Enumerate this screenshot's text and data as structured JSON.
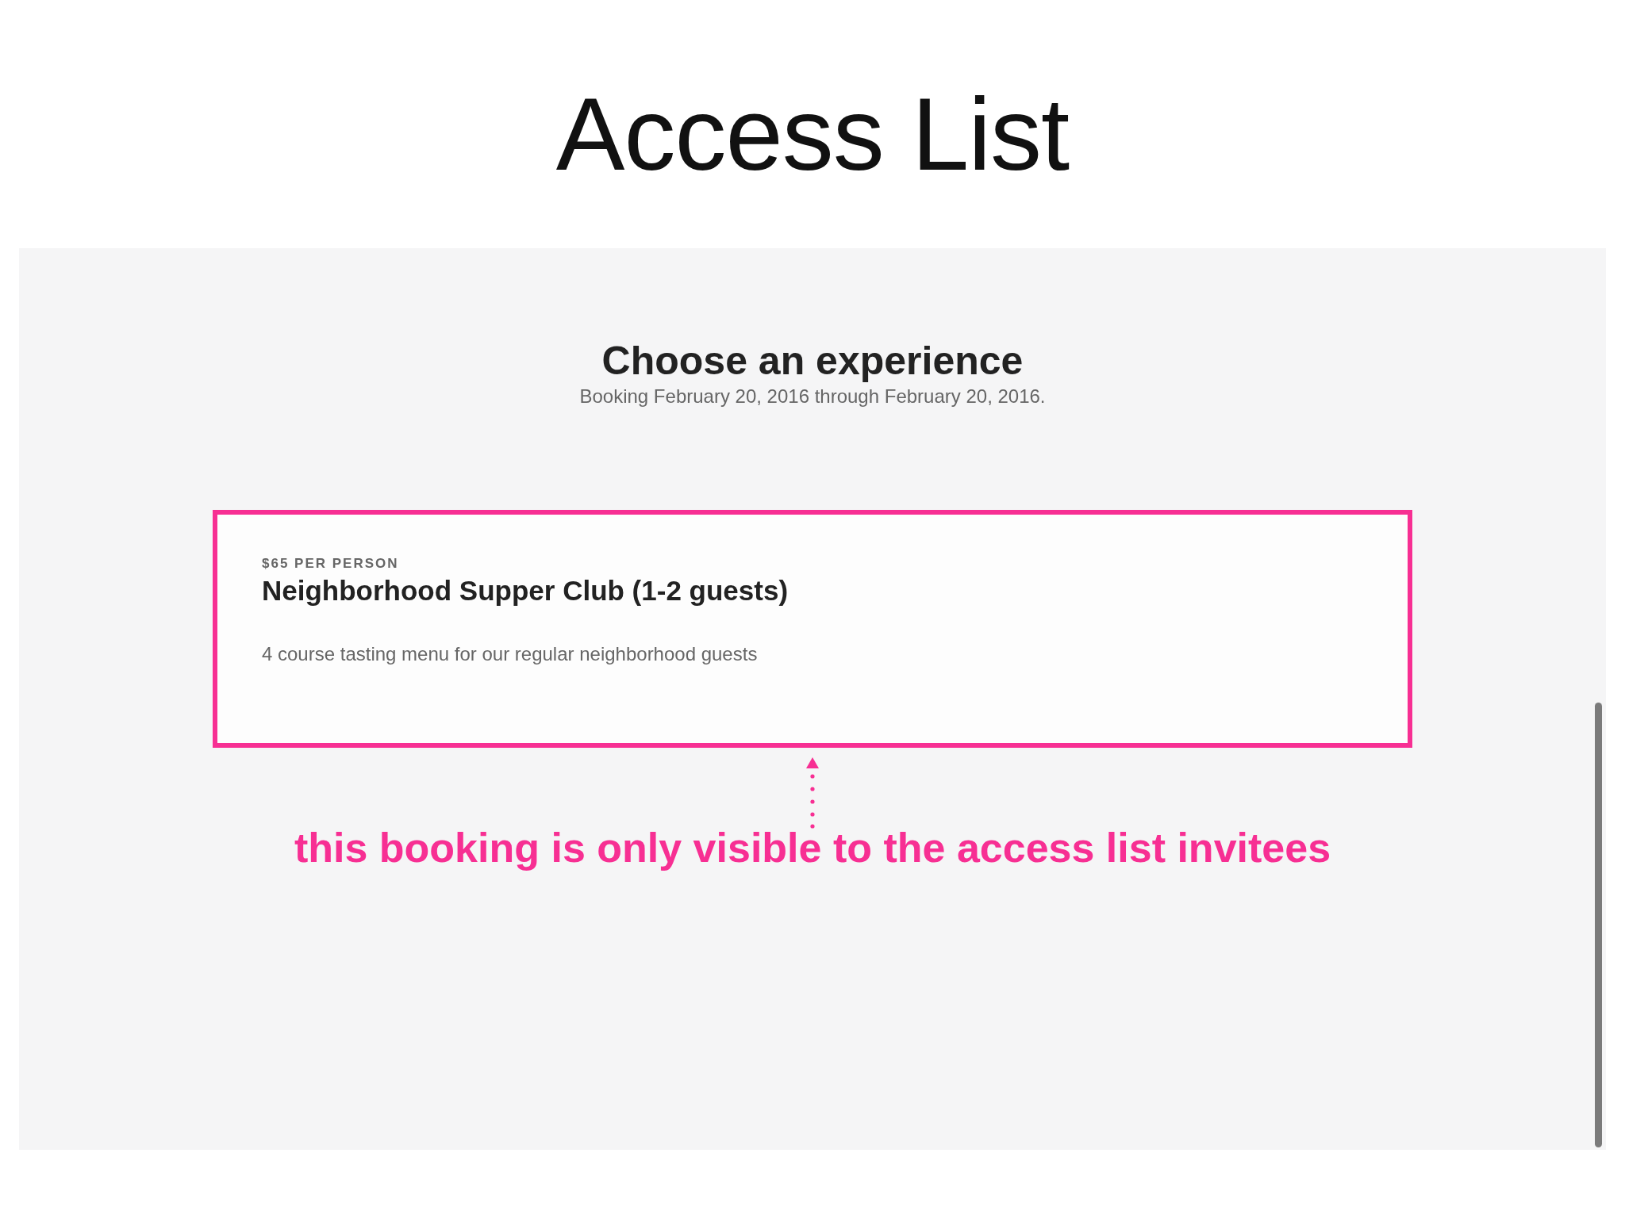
{
  "page_title": "Access List",
  "booking_page": {
    "heading": "Choose an experience",
    "subheading": "Booking February 20, 2016 through February 20, 2016.",
    "experiences": [
      {
        "price": "$65 PER PERSON",
        "name": "Neighborhood Supper Club (1-2 guests)",
        "description": "4 course tasting menu for our regular neighborhood guests",
        "highlighted": true
      }
    ]
  },
  "annotation": {
    "text": "this booking is only visible to the access list invitees"
  }
}
